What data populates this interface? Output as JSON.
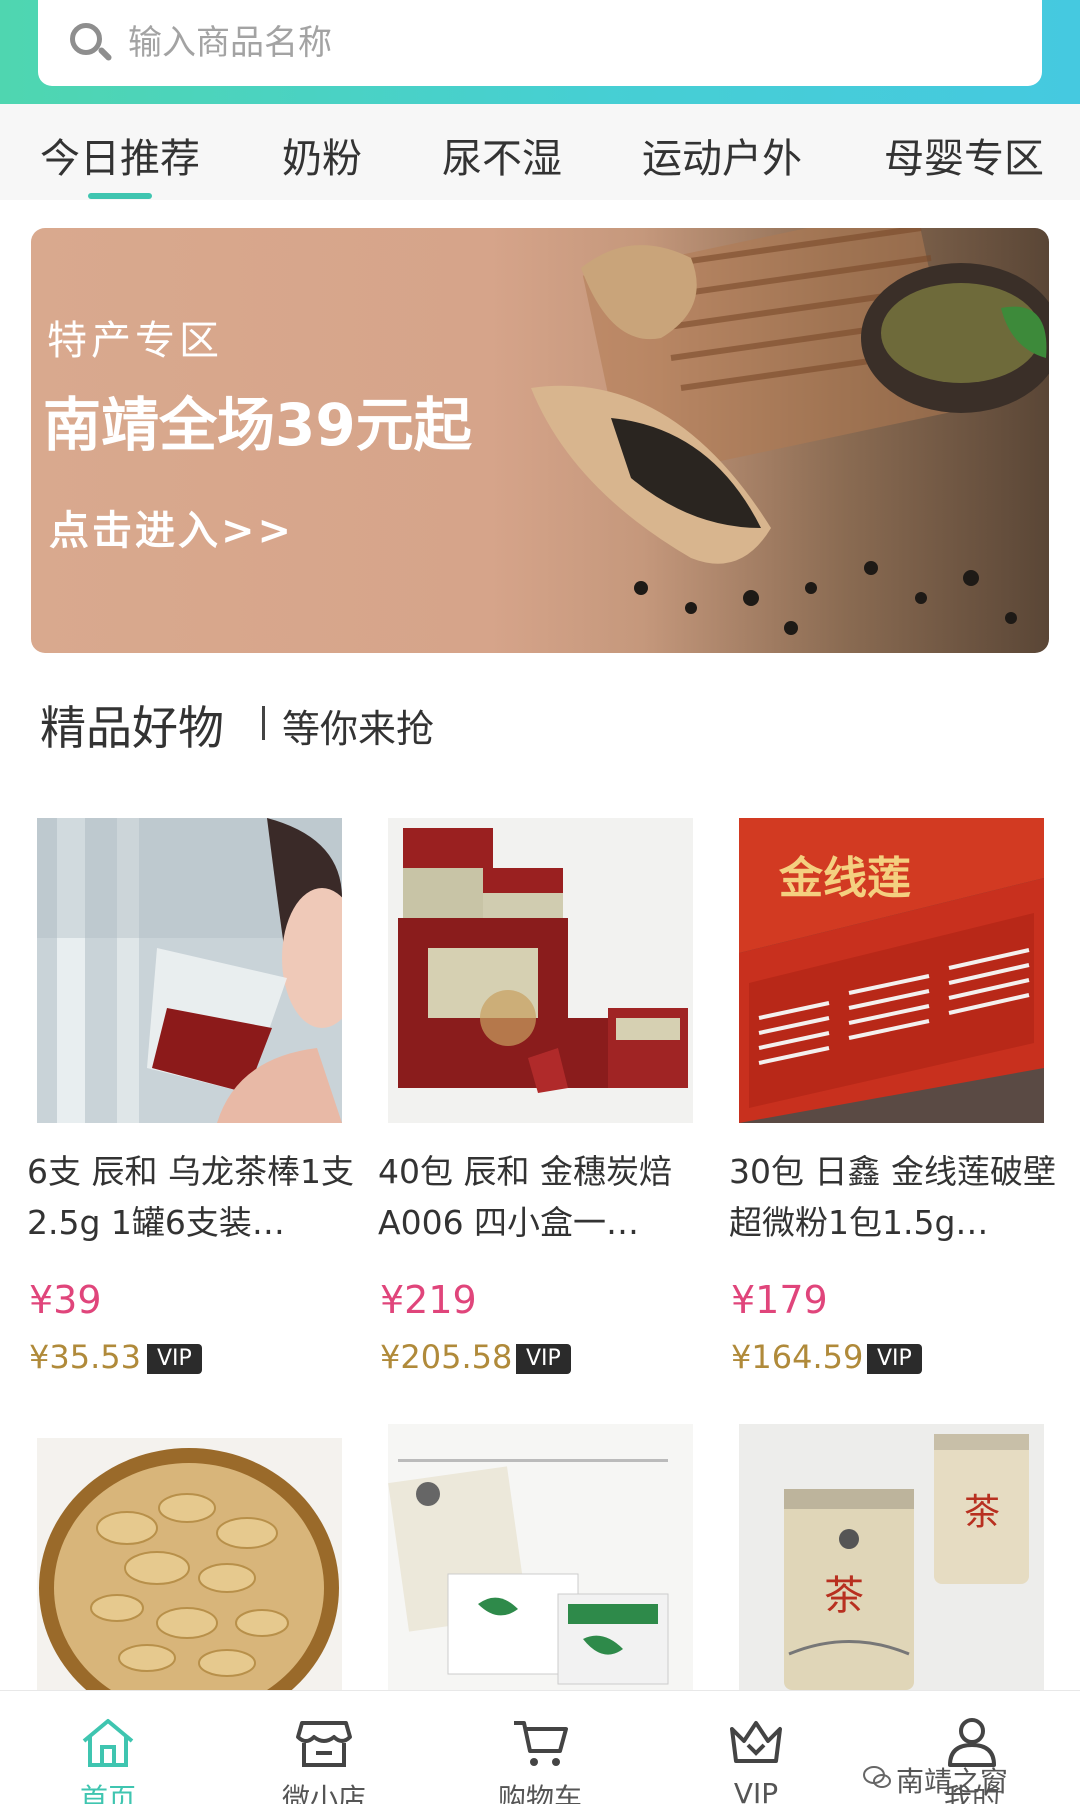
{
  "search": {
    "placeholder": "输入商品名称"
  },
  "tabs": [
    {
      "label": "今日推荐",
      "active": true
    },
    {
      "label": "奶粉"
    },
    {
      "label": "尿不湿"
    },
    {
      "label": "运动户外"
    },
    {
      "label": "母婴专区"
    }
  ],
  "banner": {
    "title": "特产专区",
    "main": "南靖全场39元起",
    "cta": "点击进入>>"
  },
  "section": {
    "title": "精品好物",
    "subtitle": "等你来抢"
  },
  "products": [
    {
      "name": "6支  辰和  乌龙茶棒1支2.5g  1罐6支装…",
      "price": "¥39",
      "vip_price": "¥35.53",
      "vip_label": "VIP"
    },
    {
      "name": "40包  辰和  金穗炭焙A006   四小盒一…",
      "price": "¥219",
      "vip_price": "¥205.58",
      "vip_label": "VIP"
    },
    {
      "name": "30包 日鑫 金线莲破壁超微粉1包1.5g…",
      "price": "¥179",
      "vip_price": "¥164.59",
      "vip_label": "VIP"
    },
    {
      "name": ""
    },
    {
      "name": ""
    },
    {
      "name": ""
    }
  ],
  "nav": [
    {
      "label": "首页",
      "icon": "home-icon",
      "active": true
    },
    {
      "label": "微小店",
      "icon": "shop-icon"
    },
    {
      "label": "购物车",
      "icon": "cart-icon"
    },
    {
      "label": "VIP",
      "icon": "crown-icon"
    },
    {
      "label": "我的",
      "icon": "user-icon"
    }
  ],
  "watermark": "南靖之窗",
  "colors": {
    "accent": "#3fc5b0",
    "price": "#e0457b",
    "vip_price": "#b08a3a"
  }
}
